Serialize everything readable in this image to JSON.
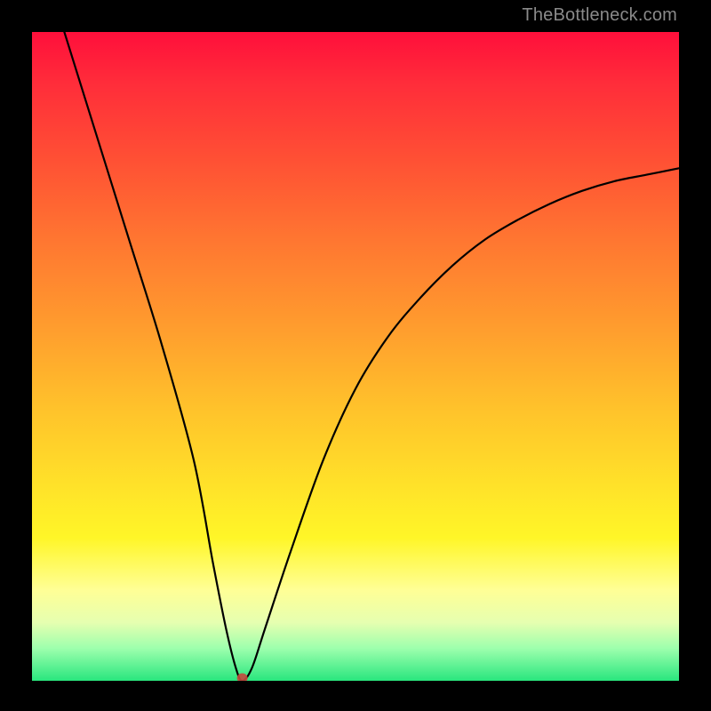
{
  "watermark": "TheBottleneck.com",
  "chart_data": {
    "type": "line",
    "title": "",
    "xlabel": "",
    "ylabel": "",
    "xlim": [
      0,
      100
    ],
    "ylim": [
      0,
      100
    ],
    "series": [
      {
        "name": "bottleneck-curve",
        "x": [
          5,
          10,
          15,
          20,
          25,
          28,
          30,
          31.5,
          32.5,
          34,
          36,
          40,
          45,
          50,
          55,
          60,
          65,
          70,
          75,
          80,
          85,
          90,
          95,
          100
        ],
        "y": [
          100,
          84,
          68,
          52,
          34,
          18,
          8,
          2,
          0,
          2,
          8,
          20,
          34,
          45,
          53,
          59,
          64,
          68,
          71,
          73.5,
          75.5,
          77,
          78,
          79
        ]
      }
    ],
    "marker": {
      "name": "min-point",
      "x": 32.5,
      "y": 0,
      "color": "#c44a3e"
    },
    "colors": {
      "curve": "#000000",
      "background_top": "#ff0f3b",
      "background_bottom": "#29e67e"
    }
  }
}
